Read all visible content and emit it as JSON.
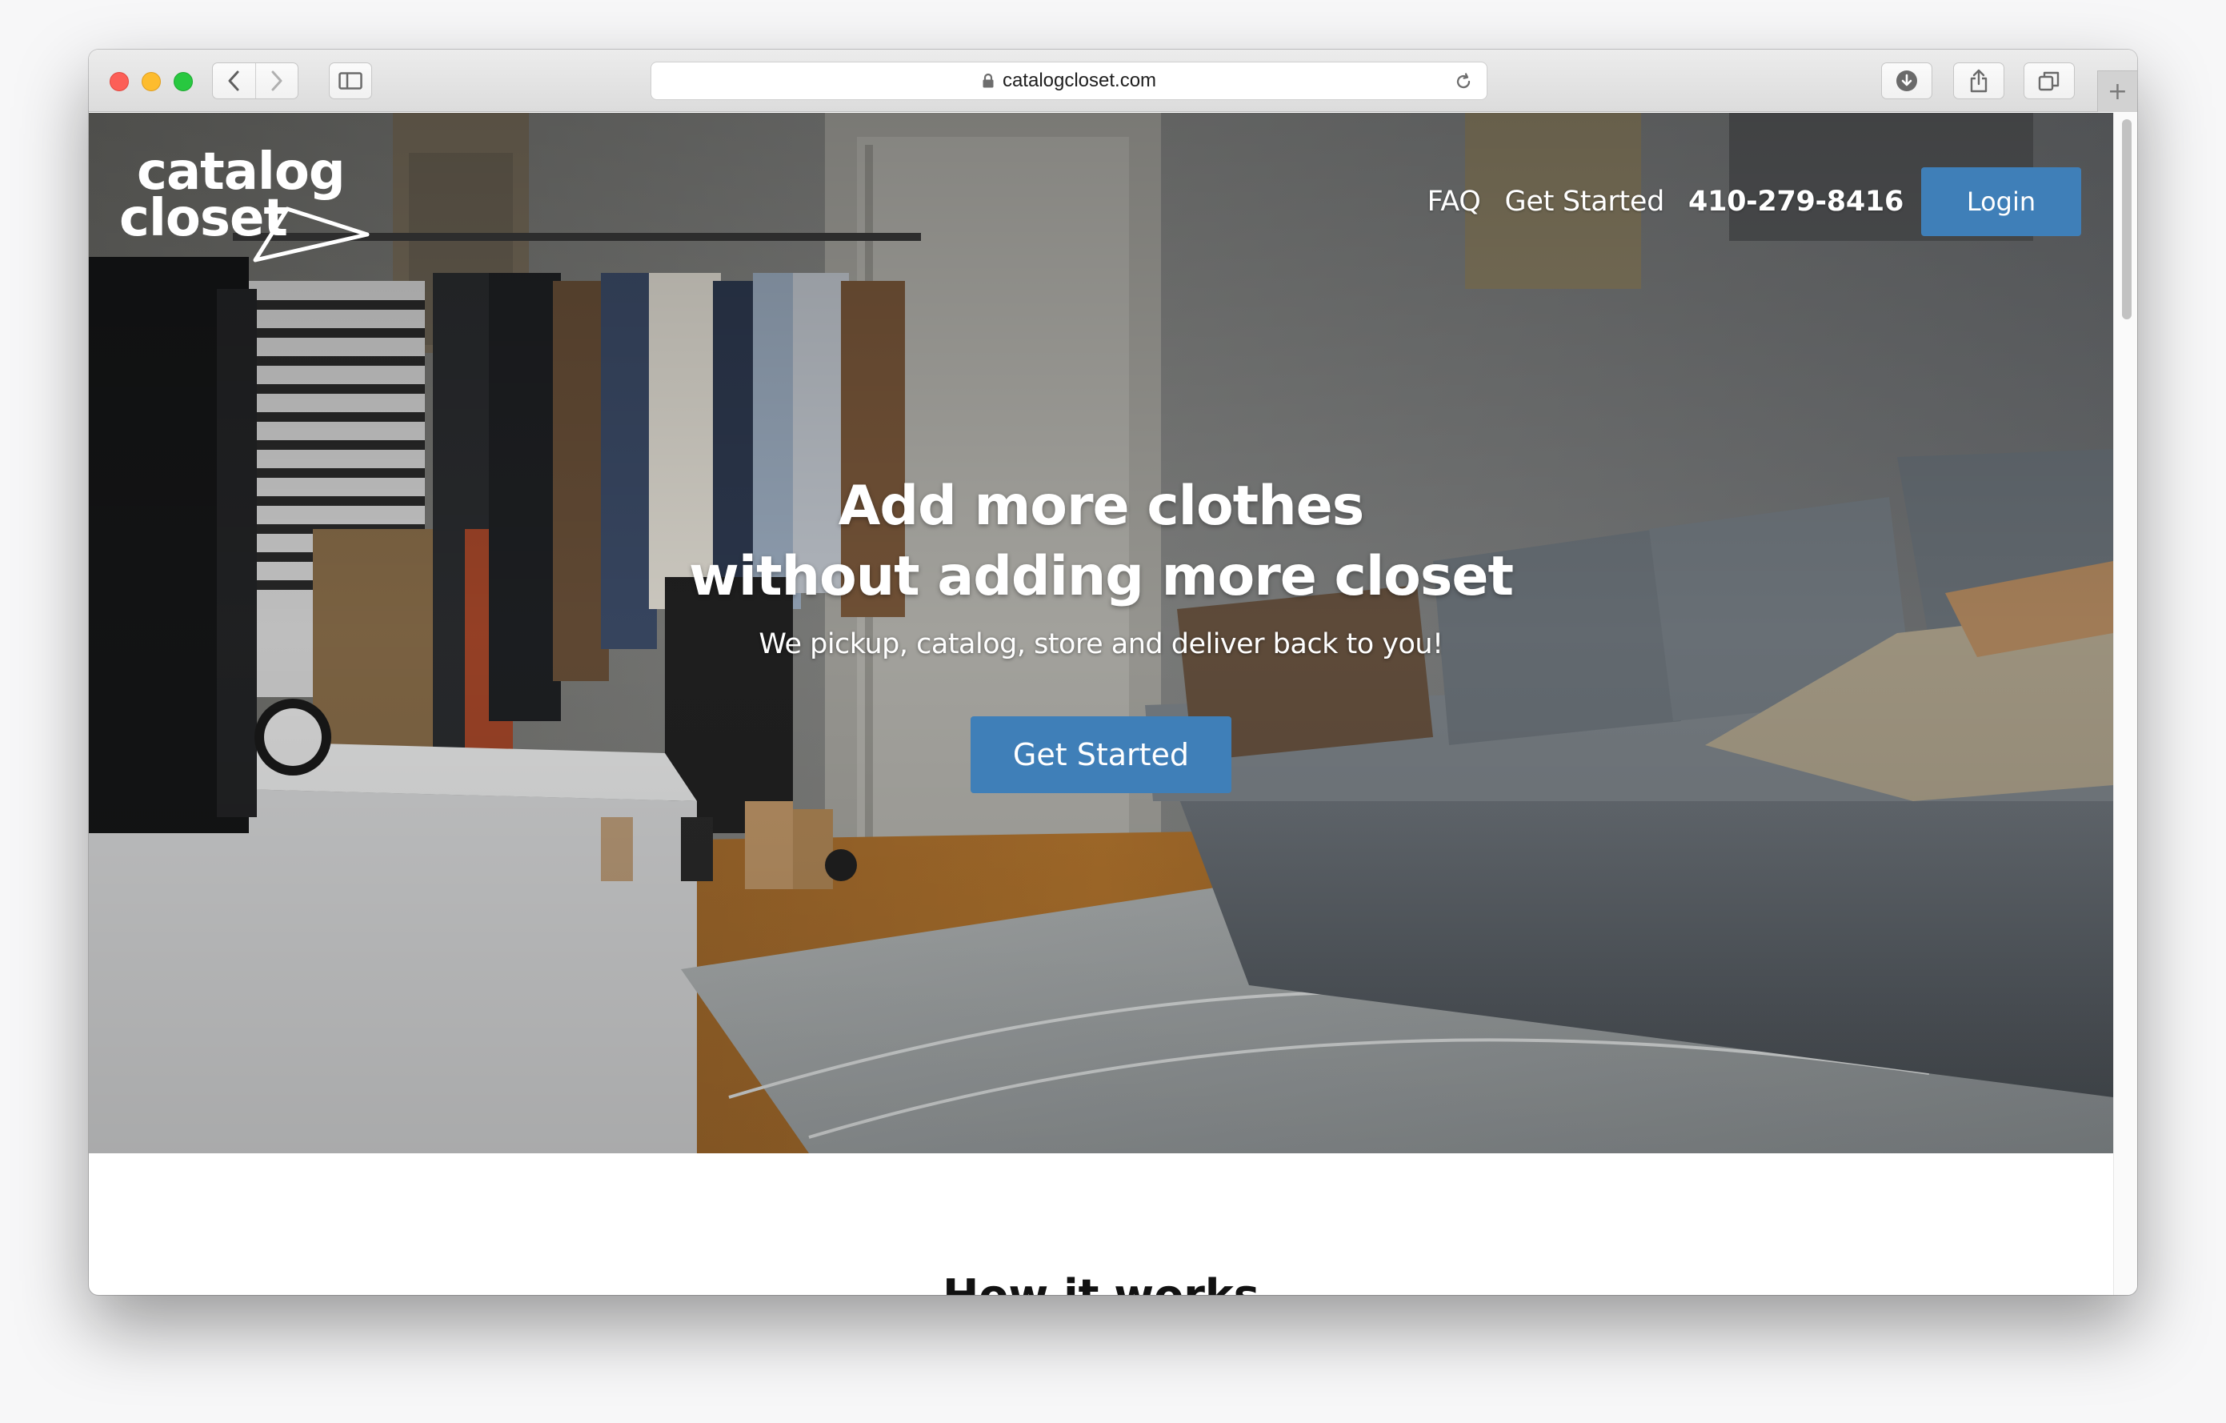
{
  "browser": {
    "url": "catalogcloset.com"
  },
  "site": {
    "logo": {
      "line1": "catalog",
      "line2": "closet"
    },
    "nav": {
      "faq": "FAQ",
      "get_started": "Get Started",
      "phone": "410-279-8416",
      "login": "Login"
    },
    "hero": {
      "title_line1": "Add more clothes",
      "title_line2": "without adding more closet",
      "subtitle": "We pickup, catalog, store and deliver back to you!",
      "cta": "Get Started"
    },
    "section": {
      "title": "How it works"
    }
  },
  "colors": {
    "accent": "#3f7fb8",
    "page_background": "#ffffff",
    "traffic_red": "#fc5f57",
    "traffic_yellow": "#fdbc2e",
    "traffic_green": "#28c840"
  }
}
